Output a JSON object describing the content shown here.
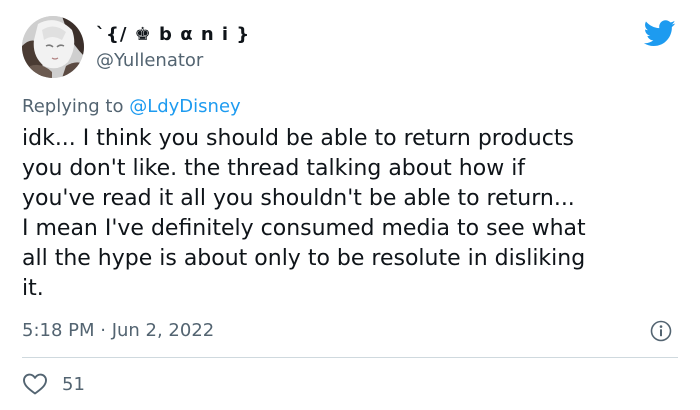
{
  "tweet": {
    "author": {
      "display_name": "`{/ ♚ b α n i }",
      "handle": "@Yullenator"
    },
    "reply_to": {
      "prefix": "Replying to ",
      "handle": "@LdyDisney"
    },
    "text_lines": [
      "idk... I think you should be able to return products",
      "you don't like. the thread talking about how if",
      "you've read it all you shouldn't be able to return...",
      "I mean I've definitely consumed media to see what",
      "all the hype is about only to be resolute in disliking",
      "it."
    ],
    "timestamp": "5:18 PM · Jun 2, 2022",
    "likes": "51"
  },
  "icons": {
    "brand": "twitter-bird-icon",
    "info": "info-icon",
    "like": "heart-icon"
  },
  "colors": {
    "brand_blue": "#1d9bf0",
    "secondary_text": "#536471",
    "primary_text": "#0f1419",
    "divider": "#cfd9de"
  }
}
